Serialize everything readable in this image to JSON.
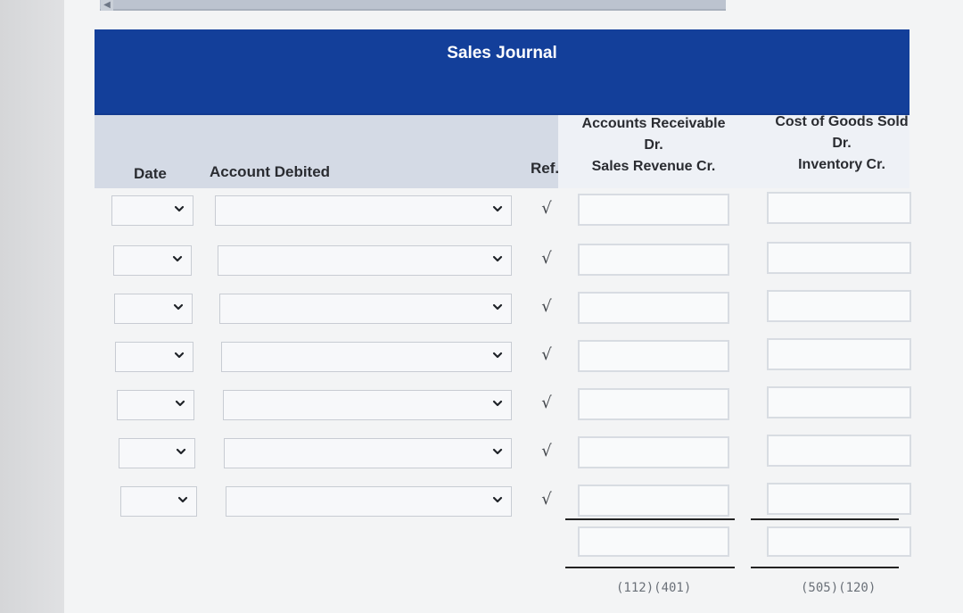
{
  "journal": {
    "title": "Sales Journal",
    "headers": {
      "date": "Date",
      "account_debited": "Account Debited",
      "ref": "Ref.",
      "ar_line1": "Accounts Receivable",
      "ar_line2": "Dr.",
      "ar_line3": "Sales Revenue Cr.",
      "cogs_line1": "Cost of Goods Sold",
      "cogs_line2": "Dr.",
      "cogs_line3": "Inventory Cr."
    },
    "rows": [
      {
        "ref_mark": "√"
      },
      {
        "ref_mark": "√"
      },
      {
        "ref_mark": "√"
      },
      {
        "ref_mark": "√"
      },
      {
        "ref_mark": "√"
      },
      {
        "ref_mark": "√"
      },
      {
        "ref_mark": "√"
      }
    ],
    "footer": {
      "ar_codes": "(112)(401)",
      "cogs_codes": "(505)(120)"
    }
  },
  "icons": {
    "dropdown": "chevron-down-icon",
    "ref_check": "checkmark-icon"
  },
  "colors": {
    "title_bar": "#133f9a",
    "header_band": "#d4dae5"
  }
}
